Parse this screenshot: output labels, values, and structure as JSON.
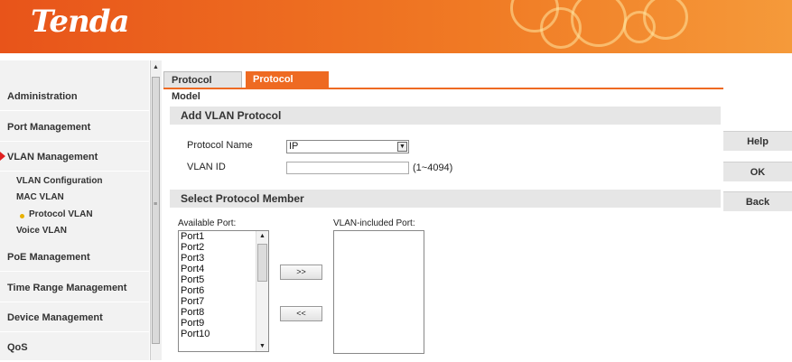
{
  "header": {
    "logo_text": "Tenda",
    "brand_color": "#ee6a22"
  },
  "sidebar": {
    "items": [
      {
        "label": "Administration"
      },
      {
        "label": "Port Management"
      },
      {
        "label": "VLAN Management",
        "active": true
      },
      {
        "label": "PoE Management"
      },
      {
        "label": "Time Range Management"
      },
      {
        "label": "Device Management"
      },
      {
        "label": "QoS"
      }
    ],
    "vlan_sub": [
      {
        "label": "VLAN Configuration"
      },
      {
        "label": "MAC VLAN"
      },
      {
        "label": "Protocol VLAN",
        "active": true
      },
      {
        "label": "Voice VLAN"
      }
    ]
  },
  "tabs": [
    {
      "label": "Protocol Model",
      "active": false
    },
    {
      "label": "Protocol VLAN",
      "active": true
    }
  ],
  "form": {
    "section_add": "Add VLAN Protocol",
    "protocol_name_label": "Protocol Name",
    "protocol_name_value": "IP",
    "vlan_id_label": "VLAN ID",
    "vlan_id_value": "",
    "vlan_id_hint": "(1~4094)",
    "section_member": "Select Protocol Member",
    "available_label": "Available Port:",
    "included_label": "VLAN-included Port:",
    "available_ports": [
      "Port1",
      "Port2",
      "Port3",
      "Port4",
      "Port5",
      "Port6",
      "Port7",
      "Port8",
      "Port9",
      "Port10"
    ],
    "add_button": ">>",
    "remove_button": "<<"
  },
  "actions": {
    "help": "Help",
    "ok": "OK",
    "back": "Back"
  }
}
